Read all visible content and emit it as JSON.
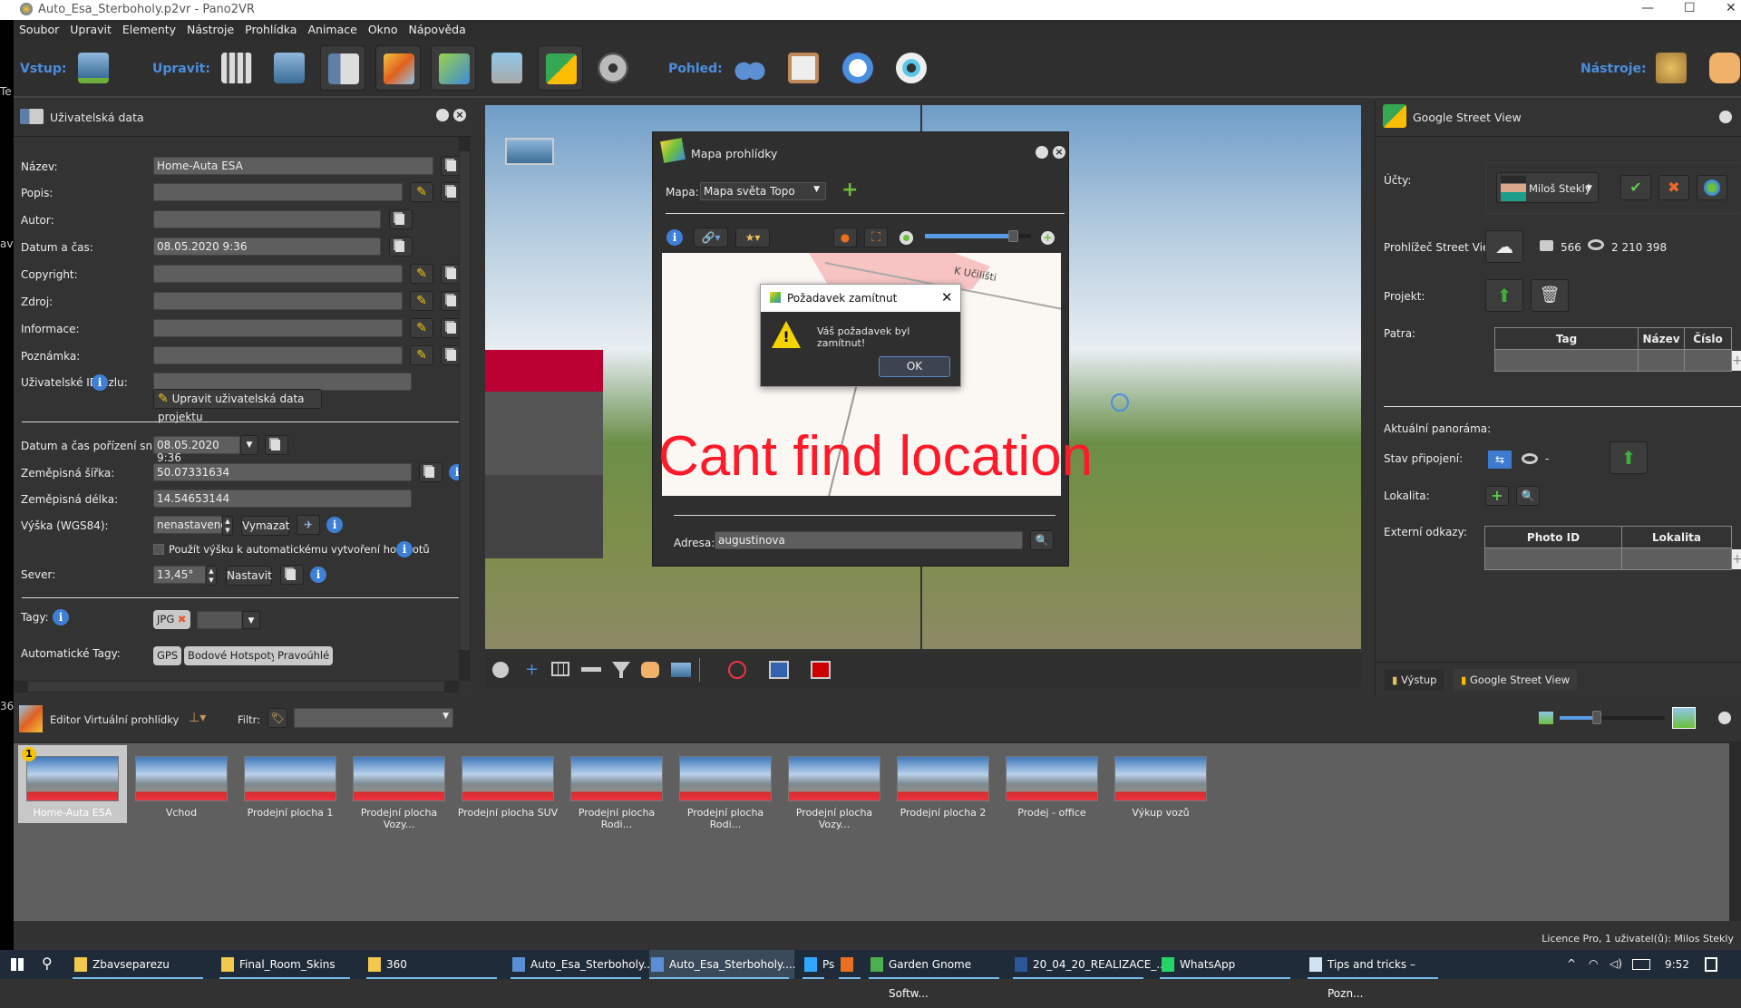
{
  "window": {
    "title": "Auto_Esa_Sterboholy.p2vr - Pano2VR",
    "minimize": "—",
    "maximize": "☐",
    "close": "✕"
  },
  "left_strip": [
    "Te",
    "av",
    "36"
  ],
  "menu": [
    "Soubor",
    "Upravit",
    "Elementy",
    "Nástroje",
    "Prohlídka",
    "Animace",
    "Okno",
    "Nápověda"
  ],
  "toolbar": {
    "input_label": "Vstup:",
    "edit_label": "Upravit:",
    "view_label": "Pohled:",
    "tools_label": "Nástroje:"
  },
  "user_data": {
    "title": "Uživatelská data",
    "fields": [
      {
        "label": "Název:",
        "value": "Home-Auta ESA"
      },
      {
        "label": "Popis:",
        "value": ""
      },
      {
        "label": "Autor:",
        "value": ""
      },
      {
        "label": "Datum a čas:",
        "value": "08.05.2020 9:36"
      },
      {
        "label": "Copyright:",
        "value": ""
      },
      {
        "label": "Zdroj:",
        "value": ""
      },
      {
        "label": "Informace:",
        "value": ""
      },
      {
        "label": "Poznámka:",
        "value": ""
      },
      {
        "label": "Uživatelské ID uzlu:",
        "value": ""
      }
    ],
    "edit_project_button": "Upravit uživatelská data projektu",
    "capture_label": "Datum a čas pořízení snímku:",
    "capture_value": "08.05.2020 9:36",
    "lat_label": "Zeměpisná šířka:",
    "lat_value": "50.07331634",
    "lon_label": "Zeměpisná délka:",
    "lon_value": "14.54653144",
    "alt_label": "Výška (WGS84):",
    "alt_value": "nenastaveno",
    "clear_button": "Vymazat",
    "use_alt_checkbox": "Použít výšku k automatickému vytvoření hotspotů",
    "use_alt_checked": false,
    "north_label": "Sever:",
    "north_value": "13,45°",
    "set_button": "Nastavit",
    "tags_label": "Tagy:",
    "tags": [
      "JPG"
    ],
    "auto_tags_label": "Automatické Tagy:",
    "auto_tags": [
      "GPS",
      "Bodové Hotspoty",
      "Pravoúhlé"
    ]
  },
  "map_dialog": {
    "title": "Mapa prohlídky",
    "map_label": "Mapa:",
    "map_value": "Mapa světa Topo",
    "street_label": "K Učilišti",
    "zoom_level": 0.83,
    "overlay_text": "Cant find location",
    "address_label": "Adresa:",
    "address_value": "augustinova"
  },
  "alert": {
    "title": "Požadavek zamítnut",
    "message": "Váš požadavek byl zamítnut!",
    "ok": "OK"
  },
  "street_view": {
    "title": "Google Street View",
    "accounts_label": "Účty:",
    "account_name": "Miloš Steklý",
    "viewer_label": "Prohlížeč Street View.",
    "photos_count": "566",
    "views_count": "2 210 398",
    "project_label": "Projekt:",
    "floors_label": "Patra:",
    "floors_columns": [
      "Tag",
      "Název",
      "Číslo"
    ],
    "current_label": "Aktuální panoráma:",
    "connection_label": "Stav připojení:",
    "connection_value": "-",
    "location_label": "Lokalita:",
    "external_label": "Externí odkazy:",
    "external_columns": [
      "Photo ID",
      "Lokalita"
    ]
  },
  "right_tabs": [
    "Výstup",
    "Google Street View"
  ],
  "tour_editor": {
    "title": "Editor Virtuální prohlídky",
    "filter_label": "Filtr:",
    "thumb_size": 0.35,
    "nodes": [
      "Home-Auta ESA",
      "Vchod",
      "Prodejní plocha 1",
      "Prodejní plocha Vozy...",
      "Prodejní plocha SUV",
      "Prodejní plocha Rodi...",
      "Prodejní plocha Rodi...",
      "Prodejní plocha Vozy...",
      "Prodejní plocha 2",
      "Prodej - office",
      "Výkup vozů"
    ],
    "start_badge": "1"
  },
  "status": "Licence Pro, 1 uživatel(ů): Milos Stekly",
  "taskbar": {
    "items": [
      "Zbavseparezu",
      "Final_Room_Skins",
      "360",
      "Auto_Esa_Sterboholy....",
      "Auto_Esa_Sterboholy....",
      "Ps",
      "",
      "Garden Gnome Softw...",
      "20_04_20_REALIZACE_...",
      "WhatsApp",
      "Tips and tricks – Pozn..."
    ],
    "time": "9:52"
  }
}
